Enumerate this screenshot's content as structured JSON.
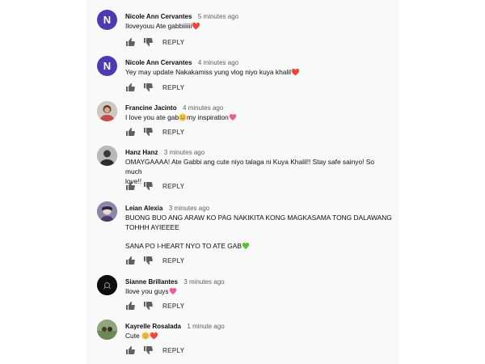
{
  "reply_label": "REPLY",
  "heart_glyph": "❤️",
  "comments": [
    {
      "author": "Nicole Ann Cervantes",
      "time": "5 minutes ago",
      "avatar_letter": "N",
      "avatar_color": "#4a3bb0",
      "lines": [
        "Iloveyouu Ate gabbiiiiii"
      ]
    },
    {
      "author": "Nicole Ann Cervantes",
      "time": "4 minutes ago",
      "avatar_letter": "N",
      "avatar_color": "#4a3bb0",
      "lines": [
        "Yey may update Nakakamiss yung vlog niyo kuya khalil"
      ]
    },
    {
      "author": "Francine Jacinto",
      "time": "4 minutes ago",
      "lines": [
        "I love you ate gab",
        "my inspiration"
      ]
    },
    {
      "author": "Hanz Hanz",
      "time": "3 minutes ago",
      "lines": [
        "OMAYGAAAA! Ate Gabbi ang cute niyo talaga ni Kuya Khalil!! Stay safe sainyo! So much",
        "love!!"
      ]
    },
    {
      "author": "Leian Alexia",
      "time": "3 minutes ago",
      "lines": [
        "BUONG BUO ANG ARAW KO PAG NAKIKITA KONG MAGKASAMA TONG DALAWANG",
        "TOHHH AYIEEEE",
        "SANA PO I-HEART NYO TO ATE GAB"
      ]
    },
    {
      "author": "Sianne Brillantes",
      "time": "3 minutes ago",
      "lines": [
        "Ilove you guys"
      ]
    },
    {
      "author": "Kayrelle Rosalada",
      "time": "1 minute ago",
      "lines": [
        "Cute"
      ]
    }
  ]
}
